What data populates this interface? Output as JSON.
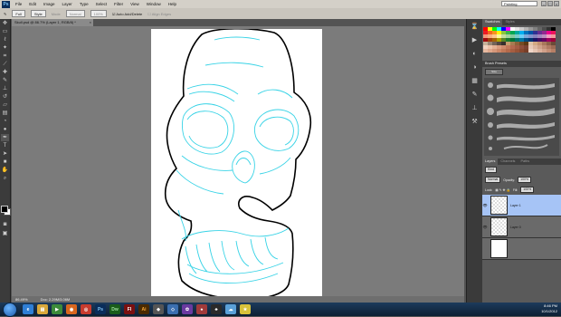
{
  "app": {
    "logo": "Ps"
  },
  "menubar": {
    "items": [
      "File",
      "Edit",
      "Image",
      "Layer",
      "Type",
      "Select",
      "Filter",
      "View",
      "Window",
      "Help"
    ],
    "workspace": "Painting"
  },
  "options_bar": {
    "tool_size": "Full",
    "style": "Style",
    "mode_label": "Mode",
    "mode_value": "Normal",
    "opacity": "100%",
    "auto_add_delete": "Auto Add/Delete",
    "align_edges": "Align Edges"
  },
  "document": {
    "tab_title": "Skull.psd @ 86.7% (Layer 1, RGB/8) *",
    "zoom": "86.49%",
    "doc_info": "Doc: 2.29M/3.06M"
  },
  "panels": {
    "swatches_tabs": [
      "Swatches",
      "Styles"
    ],
    "brush_presets_title": "Brush Presets",
    "brush_button": "Size",
    "layers_tabs": [
      "Layers",
      "Channels",
      "Paths"
    ],
    "kind_label": "Kind",
    "blend_mode": "Normal",
    "opacity_label": "Opacity:",
    "opacity_value": "100%",
    "lock_label": "Lock:",
    "fill_label": "Fill:",
    "fill_value": "100%",
    "layers": [
      {
        "name": "Layer 1",
        "selected": true
      },
      {
        "name": "Layer 0",
        "selected": false
      },
      {
        "name": "",
        "selected": false
      }
    ]
  },
  "taskbar": {
    "time": "8:46 PM",
    "date": "10/1/2012"
  },
  "colors": {
    "foreground": "#000000",
    "background": "#ffffff",
    "sketch_line": "#38d3e6",
    "outline": "#000000"
  }
}
